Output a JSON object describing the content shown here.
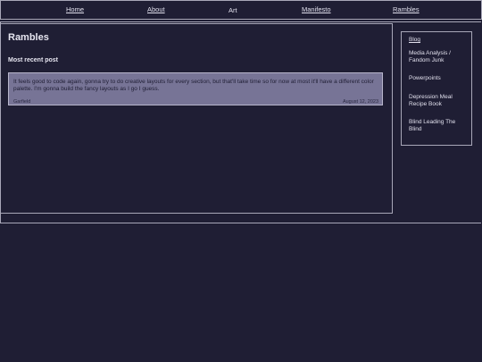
{
  "nav": {
    "items": [
      {
        "label": "Home"
      },
      {
        "label": "About"
      },
      {
        "label": "Art"
      },
      {
        "label": "Manifesto"
      },
      {
        "label": "Rambles"
      }
    ]
  },
  "main": {
    "title": "Rambles",
    "section_heading": "Most recent post",
    "post": {
      "text": "It feels good to code again, gonna try to do creative layouts for every section, but that'll take time so for now at most it'll have a different color palette. I'm gonna build the fancy layouts as I go I guess.",
      "author": "Garfield",
      "date": "August 12, 2023"
    }
  },
  "sidebar": {
    "items": [
      {
        "label": "Blog"
      },
      {
        "label": "Media Analysis / Fandom Junk"
      },
      {
        "label": "Powerpoints"
      },
      {
        "label": "Depression Meal Recipe Book"
      },
      {
        "label": "Blind Leading The Blind"
      }
    ]
  },
  "colors": {
    "background": "#1f1e34",
    "card": "#777496",
    "border": "#a8a7b8"
  }
}
